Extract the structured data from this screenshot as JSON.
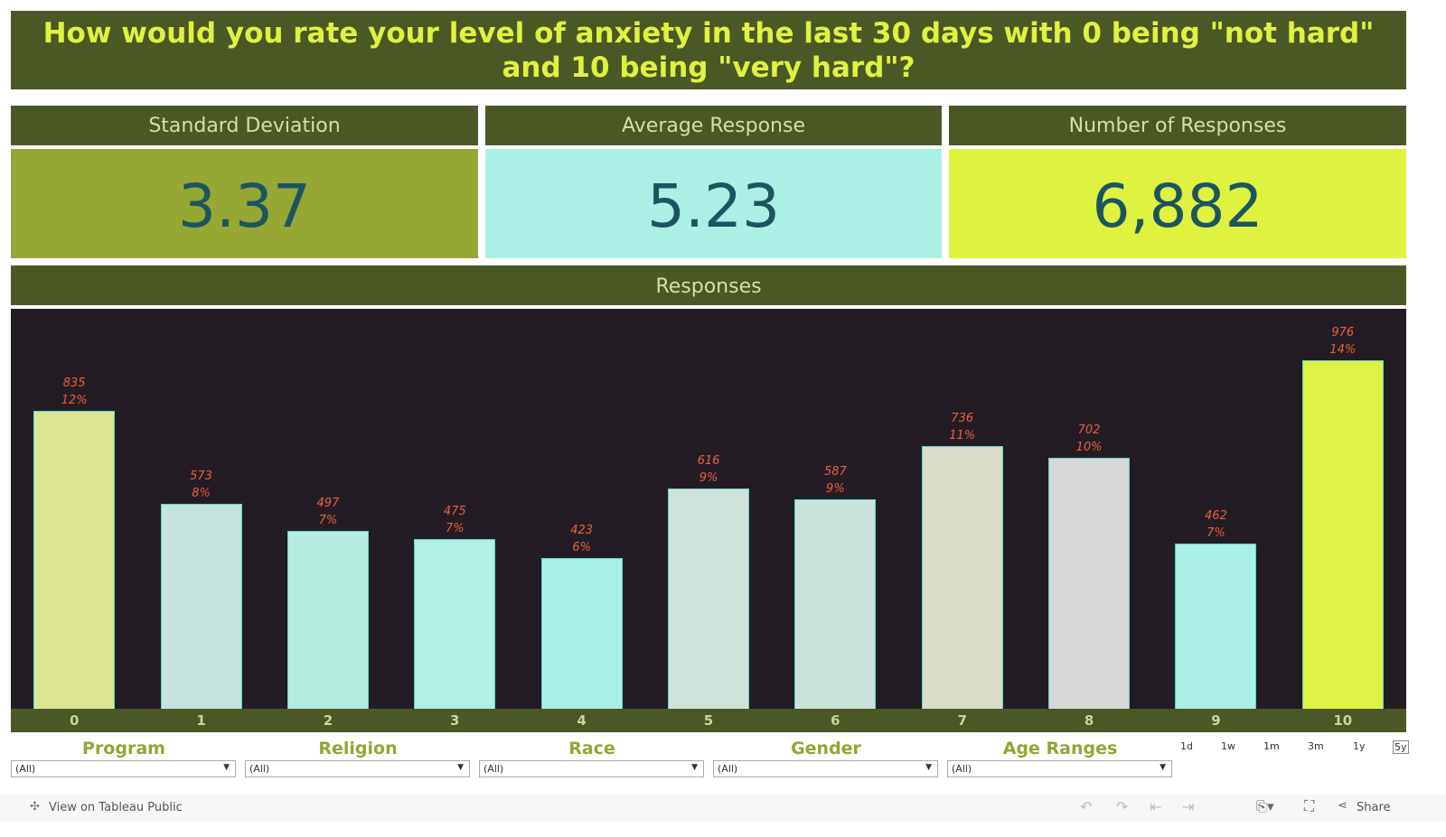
{
  "title": "How would you rate your level of anxiety in the last 30 days with 0 being \"not hard\" and 10 being \"very hard\"?",
  "kpis": [
    {
      "label": "Standard Deviation",
      "value": "3.37",
      "color": "#97a733"
    },
    {
      "label": "Average Response",
      "value": "5.23",
      "color": "#aaf0e4"
    },
    {
      "label": "Number of Responses",
      "value": "6,882",
      "color": "#dff23f"
    }
  ],
  "chart_data": {
    "type": "bar",
    "title": "Responses",
    "categories": [
      "0",
      "1",
      "2",
      "3",
      "4",
      "5",
      "6",
      "7",
      "8",
      "9",
      "10"
    ],
    "values": [
      835,
      573,
      497,
      475,
      423,
      616,
      587,
      736,
      702,
      462,
      976
    ],
    "percent_labels": [
      "12%",
      "8%",
      "7%",
      "7%",
      "6%",
      "9%",
      "9%",
      "11%",
      "10%",
      "7%",
      "14%"
    ],
    "colors": [
      "#dce591",
      "#c4e3dd",
      "#b3ede0",
      "#b0efe2",
      "#a9f0e4",
      "#cde3da",
      "#c9e3dc",
      "#d9dcc8",
      "#d8d8d8",
      "#aaf0e4",
      "#e0f244"
    ],
    "ylim": [
      0,
      1120
    ],
    "grid": false
  },
  "filters": [
    {
      "label": "Program",
      "value": "(All)"
    },
    {
      "label": "Religion",
      "value": "(All)"
    },
    {
      "label": "Race",
      "value": "(All)"
    },
    {
      "label": "Gender",
      "value": "(All)"
    },
    {
      "label": "Age Ranges",
      "value": "(All)"
    }
  ],
  "ranges": [
    "1d",
    "1w",
    "1m",
    "3m",
    "1y",
    "5y"
  ],
  "footer": {
    "view_label": "View on Tableau Public",
    "share_label": "Share"
  }
}
